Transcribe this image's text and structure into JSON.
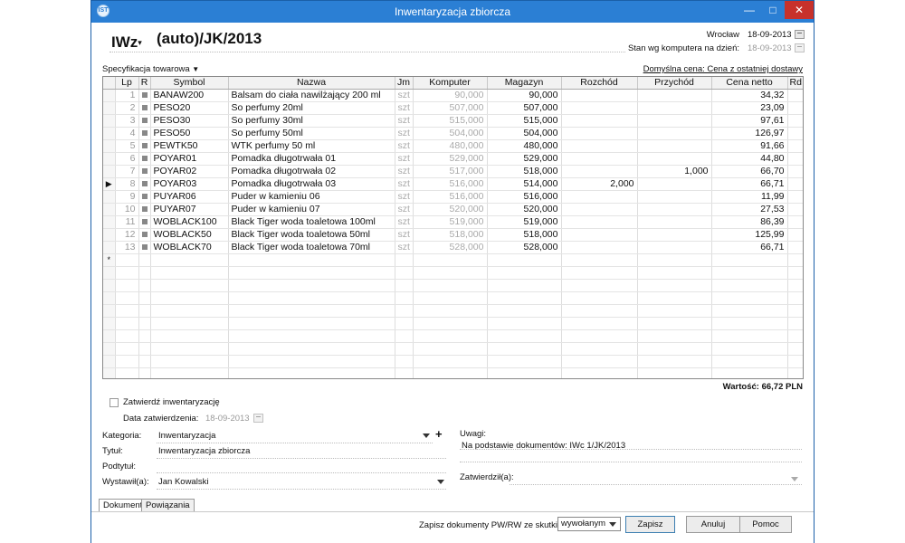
{
  "window": {
    "title": "Inwentaryzacja zbiorcza",
    "app_icon": "IST",
    "minimize_glyph": "—",
    "maximize_glyph": "□",
    "close_glyph": "✕"
  },
  "header": {
    "doc_type": "IWz",
    "doc_type_caret": "▾",
    "doc_number": "(auto)/JK/2013",
    "place_label": "Wrocław",
    "place_date": "18-09-2013",
    "stock_label": "Stan wg komputera na dzień:",
    "stock_date": "18-09-2013"
  },
  "spec": {
    "label": "Specyfikacja towarowa",
    "caret": "▼",
    "default_price": "Domyślna cena: Cena z ostatniej dostawy"
  },
  "table": {
    "columns": [
      "",
      "Lp",
      "R",
      "Symbol",
      "Nazwa",
      "Jm",
      "Komputer",
      "Magazyn",
      "Rozchód",
      "Przychód",
      "Cena netto",
      "Rd"
    ],
    "rows": [
      {
        "ind": "",
        "lp": "1",
        "symbol": "BANAW200",
        "nazwa": "Balsam do ciała nawilżający 200 ml",
        "jm": "szt",
        "komputer": "90,000",
        "magazyn": "90,000",
        "rozchod": "",
        "przychod": "",
        "cena": "34,32"
      },
      {
        "ind": "",
        "lp": "2",
        "symbol": "PESO20",
        "nazwa": "So perfumy 20ml",
        "jm": "szt",
        "komputer": "507,000",
        "magazyn": "507,000",
        "rozchod": "",
        "przychod": "",
        "cena": "23,09"
      },
      {
        "ind": "",
        "lp": "3",
        "symbol": "PESO30",
        "nazwa": "So perfumy 30ml",
        "jm": "szt",
        "komputer": "515,000",
        "magazyn": "515,000",
        "rozchod": "",
        "przychod": "",
        "cena": "97,61"
      },
      {
        "ind": "",
        "lp": "4",
        "symbol": "PESO50",
        "nazwa": "So perfumy 50ml",
        "jm": "szt",
        "komputer": "504,000",
        "magazyn": "504,000",
        "rozchod": "",
        "przychod": "",
        "cena": "126,97"
      },
      {
        "ind": "",
        "lp": "5",
        "symbol": "PEWTK50",
        "nazwa": "WTK perfumy 50 ml",
        "jm": "szt",
        "komputer": "480,000",
        "magazyn": "480,000",
        "rozchod": "",
        "przychod": "",
        "cena": "91,66"
      },
      {
        "ind": "",
        "lp": "6",
        "symbol": "POYAR01",
        "nazwa": "Pomadka długotrwała 01",
        "jm": "szt",
        "komputer": "529,000",
        "magazyn": "529,000",
        "rozchod": "",
        "przychod": "",
        "cena": "44,80"
      },
      {
        "ind": "",
        "lp": "7",
        "symbol": "POYAR02",
        "nazwa": "Pomadka długotrwała 02",
        "jm": "szt",
        "komputer": "517,000",
        "magazyn": "518,000",
        "rozchod": "",
        "przychod": "1,000",
        "cena": "66,70"
      },
      {
        "ind": "▶",
        "lp": "8",
        "symbol": "POYAR03",
        "nazwa": "Pomadka długotrwała 03",
        "jm": "szt",
        "komputer": "516,000",
        "magazyn": "514,000",
        "rozchod": "2,000",
        "przychod": "",
        "cena": "66,71"
      },
      {
        "ind": "",
        "lp": "9",
        "symbol": "PUYAR06",
        "nazwa": "Puder w kamieniu 06",
        "jm": "szt",
        "komputer": "516,000",
        "magazyn": "516,000",
        "rozchod": "",
        "przychod": "",
        "cena": "11,99"
      },
      {
        "ind": "",
        "lp": "10",
        "symbol": "PUYAR07",
        "nazwa": "Puder w kamieniu 07",
        "jm": "szt",
        "komputer": "520,000",
        "magazyn": "520,000",
        "rozchod": "",
        "przychod": "",
        "cena": "27,53"
      },
      {
        "ind": "",
        "lp": "11",
        "symbol": "WOBLACK100",
        "nazwa": "Black Tiger woda toaletowa 100ml",
        "jm": "szt",
        "komputer": "519,000",
        "magazyn": "519,000",
        "rozchod": "",
        "przychod": "",
        "cena": "86,39"
      },
      {
        "ind": "",
        "lp": "12",
        "symbol": "WOBLACK50",
        "nazwa": "Black Tiger woda toaletowa 50ml",
        "jm": "szt",
        "komputer": "518,000",
        "magazyn": "518,000",
        "rozchod": "",
        "przychod": "",
        "cena": "125,99"
      },
      {
        "ind": "",
        "lp": "13",
        "symbol": "WOBLACK70",
        "nazwa": "Black Tiger woda toaletowa 70ml",
        "jm": "szt",
        "komputer": "528,000",
        "magazyn": "528,000",
        "rozchod": "",
        "przychod": "",
        "cena": "66,71"
      }
    ],
    "new_row_marker": "*",
    "empty_rows": 10
  },
  "summary": {
    "wartosc": "Wartość: 66,72 PLN"
  },
  "form": {
    "approve_label": "Zatwierdź inwentaryzację",
    "approve_date_label": "Data zatwierdzenia:",
    "approve_date": "18-09-2013",
    "kategoria_label": "Kategoria:",
    "kategoria_value": "Inwentaryzacja",
    "tytul_label": "Tytuł:",
    "tytul_value": "Inwentaryzacja zbiorcza",
    "podtytul_label": "Podtytuł:",
    "wystawil_label": "Wystawił(a):",
    "wystawil_value": "Jan Kowalski",
    "uwagi_label": "Uwagi:",
    "uwagi_value": "Na podstawie dokumentów: IWc 1/JK/2013",
    "zatwierdzil_label": "Zatwierdził(a):",
    "plus_glyph": "+"
  },
  "tabs": {
    "dokument": "Dokument",
    "powiazania": "Powiązania"
  },
  "footer": {
    "save_label": "Zapisz dokumenty PW/RW ze skutkiem:",
    "effect_value": "wywołanym",
    "zapisz": "Zapisz",
    "anuluj": "Anuluj",
    "pomoc": "Pomoc"
  }
}
